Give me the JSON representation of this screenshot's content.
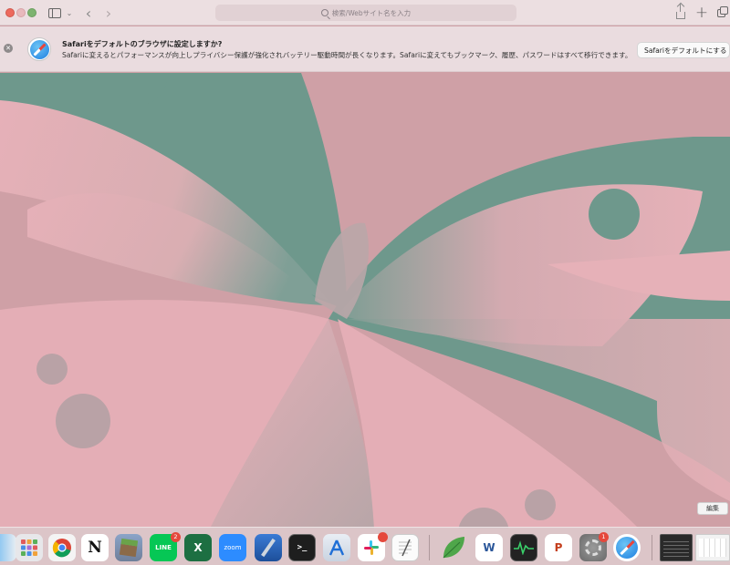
{
  "toolbar": {
    "address_placeholder": "検索/Webサイト名を入力",
    "tab_group_chevron": "⌄",
    "back_glyph": "‹",
    "forward_glyph": "›",
    "new_tab_glyph": "+"
  },
  "banner": {
    "close_glyph": "✕",
    "title": "Safariをデフォルトのブラウザに設定しますか?",
    "description": "Safariに変えるとパフォーマンスが向上しプライバシー保護が強化されバッテリー駆動時間が長くなります。Safariに変えてもブックマーク、履歴、パスワードはすべて移行できます。",
    "button_label": "Safariをデフォルトにする"
  },
  "desktop": {
    "edit_button_label": "編集"
  },
  "dock": {
    "items": [
      {
        "name": "Finder",
        "icon": "finder-icon",
        "label": ""
      },
      {
        "name": "Launchpad",
        "icon": "launchpad-icon",
        "label": ""
      },
      {
        "name": "Google Chrome",
        "icon": "chrome-icon",
        "label": ""
      },
      {
        "name": "Notion",
        "icon": "notion-icon",
        "label": "N"
      },
      {
        "name": "Minecraft",
        "icon": "minecraft-icon",
        "label": ""
      },
      {
        "name": "LINE",
        "icon": "line-icon",
        "label": "LINE",
        "badge": "2"
      },
      {
        "name": "Microsoft Excel",
        "icon": "excel-icon",
        "label": "X"
      },
      {
        "name": "Zoom",
        "icon": "zoom-icon",
        "label": "zoom"
      },
      {
        "name": "Xcode",
        "icon": "xcode-icon",
        "label": ""
      },
      {
        "name": "Terminal",
        "icon": "terminal-icon",
        "label": ">_"
      },
      {
        "name": "Instruments",
        "icon": "instruments-icon",
        "label": ""
      },
      {
        "name": "Slack",
        "icon": "slack-icon",
        "label": "",
        "badge": ""
      },
      {
        "name": "TextEdit",
        "icon": "textedit-icon",
        "label": ""
      },
      {
        "name": "Folder",
        "icon": "leaf-icon",
        "label": ""
      },
      {
        "name": "Microsoft Word",
        "icon": "word-icon",
        "label": "W"
      },
      {
        "name": "Activity Monitor",
        "icon": "activity-monitor-icon",
        "label": ""
      },
      {
        "name": "Microsoft PowerPoint",
        "icon": "powerpoint-icon",
        "label": "P"
      },
      {
        "name": "System Settings",
        "icon": "settings-icon",
        "label": "",
        "badge": "1"
      },
      {
        "name": "Safari",
        "icon": "safari-icon",
        "label": ""
      },
      {
        "name": "Terminal window",
        "icon": "window-thumbnail",
        "label": ""
      },
      {
        "name": "Excel window",
        "icon": "window-thumbnail",
        "label": ""
      }
    ]
  },
  "colors": {
    "wallpaper_pink": "#e4aeb6",
    "wallpaper_green": "#6e988c",
    "wallpaper_mauve": "#cfa0a6"
  }
}
